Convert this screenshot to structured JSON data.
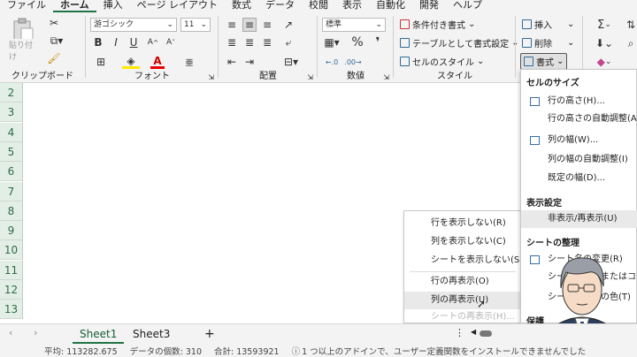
{
  "tabs": [
    "ファイル",
    "ホーム",
    "挿入",
    "ページ レイアウト",
    "数式",
    "データ",
    "校閲",
    "表示",
    "自動化",
    "開発",
    "ヘルプ"
  ],
  "active_tab_index": 1,
  "ribbon": {
    "clipboard": {
      "paste_label": "貼り付け",
      "group_label": "クリップボード"
    },
    "font": {
      "font_name": "游ゴシック",
      "font_size": "11",
      "group_label": "フォント",
      "bold": "B",
      "italic": "I",
      "underline": "U",
      "font_color_letter": "A",
      "phonetic": "亜"
    },
    "alignment": {
      "group_label": "配置"
    },
    "number": {
      "format": "標準",
      "percent": "%",
      "comma": "❜",
      "group_label": "数値"
    },
    "styles": {
      "conditional": "条件付き書式",
      "table": "テーブルとして書式設定",
      "cell_style": "セルのスタイル",
      "group_label": "スタイル"
    },
    "cells": {
      "insert": "挿入",
      "delete": "削除",
      "format": "書式"
    },
    "editing": {
      "sigma": "Σ"
    }
  },
  "rows": [
    "2",
    "3",
    "4",
    "5",
    "6",
    "7",
    "8",
    "9",
    "10",
    "11",
    "12",
    "13"
  ],
  "hide_menu": {
    "items": [
      {
        "label": "行を表示しない(R)",
        "disabled": false
      },
      {
        "label": "列を表示しない(C)",
        "disabled": false
      },
      {
        "label": "シートを表示しない(S)",
        "disabled": false
      },
      {
        "label": "行の再表示(O)",
        "disabled": false
      },
      {
        "label": "列の再表示(U)",
        "disabled": false
      },
      {
        "label": "シートの再表示(H)...",
        "disabled": true
      }
    ]
  },
  "format_menu": {
    "cell_size_header": "セルのサイズ",
    "row_height": "行の高さ(H)...",
    "autofit_row": "行の高さの自動調整(A)",
    "col_width": "列の幅(W)...",
    "autofit_col": "列の幅の自動調整(I)",
    "default_width": "既定の幅(D)...",
    "visibility_header": "表示設定",
    "hide_unhide": "非表示/再表示(U)",
    "organize_header": "シートの整理",
    "rename": "シート名の変更(R)",
    "move_copy": "シートの移動またはコピー(M)...",
    "tab_color": "シート見出しの色(T)",
    "protect_header": "保護"
  },
  "sheet_tabs": [
    "Sheet1",
    "Sheet3"
  ],
  "active_sheet_index": 0,
  "add_sheet": "+",
  "status": {
    "average": "平均: 113282.675",
    "count": "データの個数: 310",
    "sum": "合計: 13593921",
    "addin_msg": "1 つ以上のアドインで、ユーザー定義関数をインストールできませんでした"
  },
  "colors": {
    "accent": "#217346",
    "row_header_bg": "#e3efe6"
  }
}
